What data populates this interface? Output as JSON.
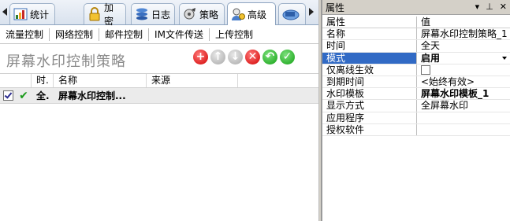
{
  "tabs": [
    {
      "label": "统计",
      "icon": "chart-icon"
    },
    {
      "label": "加密",
      "icon": "lock-icon"
    },
    {
      "label": "日志",
      "icon": "log-stack-icon"
    },
    {
      "label": "策略",
      "icon": "policy-gear-icon"
    },
    {
      "label": "高级",
      "icon": "advanced-user-icon"
    },
    {
      "label": "",
      "icon": "network-icon"
    }
  ],
  "subtabs": [
    "流量控制",
    "网络控制",
    "邮件控制",
    "IM文件传送",
    "上传控制"
  ],
  "page_title": "屏幕水印控制策略",
  "toolbar": {
    "add": "+",
    "up": "↑",
    "down": "↓",
    "delete": "✕",
    "undo": "↶",
    "apply": "✓"
  },
  "table": {
    "columns": [
      "时.",
      "名称",
      "来源"
    ],
    "rows": [
      {
        "checked": true,
        "status": "✔",
        "time": "全.",
        "name": "屏幕水印控制...",
        "source": ""
      }
    ]
  },
  "properties": {
    "title": "属性",
    "header_controls": [
      "▾",
      "×",
      "⊥",
      "✕"
    ],
    "col_name": "属性",
    "col_value": "值",
    "rows": [
      {
        "name": "名称",
        "value": "屏幕水印控制策略_1"
      },
      {
        "name": "时间",
        "value": "全天"
      },
      {
        "name": "模式",
        "value": "启用",
        "selected": true,
        "dropdown": true,
        "bold": true
      },
      {
        "name": "仅离线生效",
        "value": "",
        "checkbox": true
      },
      {
        "name": "到期时间",
        "value": "<始终有效>"
      },
      {
        "name": "水印模板",
        "value": "屏幕水印模板_1",
        "bold": true
      },
      {
        "name": "显示方式",
        "value": "全屏幕水印"
      },
      {
        "name": "应用程序",
        "value": ""
      },
      {
        "name": "授权软件",
        "value": ""
      }
    ]
  },
  "colors": {
    "selection": "#316ac5",
    "tab_border": "#8ea4c0",
    "green": "#12a012",
    "red": "#d10000"
  }
}
